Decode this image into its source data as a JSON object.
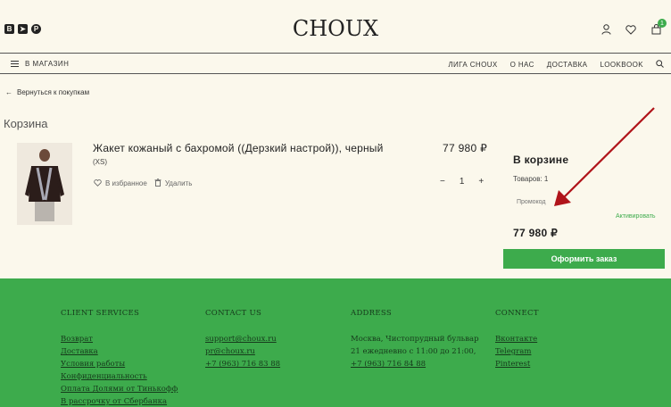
{
  "header": {
    "logo": "CHOUX",
    "social": [
      "В",
      "➤",
      "P"
    ],
    "cart_count": "1",
    "icons": [
      "user-icon",
      "heart-icon",
      "cart-icon"
    ]
  },
  "nav": {
    "shop": "В МАГАЗИН",
    "links": [
      "ЛИГА CHOUX",
      "О НАС",
      "ДОСТАВКА",
      "LOOKBOOK"
    ]
  },
  "back_link": "Вернуться к покупкам",
  "page_title": "Корзина",
  "product": {
    "name": "Жакет кожаный с бахромой ((Дерзкий настрой)), черный",
    "size": "(XS)",
    "to_favorites": "В избранное",
    "delete": "Удалить",
    "price": "77 980 ₽",
    "qty_minus": "−",
    "qty": "1",
    "qty_plus": "+"
  },
  "summary": {
    "title": "В корзине",
    "count": "Товаров: 1",
    "promo_placeholder": "Промокод",
    "activate": "Активировать",
    "total": "77 980 ₽",
    "order_button": "Оформить заказ"
  },
  "footer": {
    "client_services": {
      "heading": "CLIENT SERVICES",
      "items": [
        "Возврат",
        "Доставка",
        "Условия работы",
        "Конфиденциальность",
        "Оплата Долями от Тинькофф",
        "В рассрочку от Сбербанка"
      ]
    },
    "contact": {
      "heading": "CONTACT US",
      "items": [
        "support@choux.ru",
        "pr@choux.ru",
        "+7 (963) 716 83 88"
      ]
    },
    "address": {
      "heading": "ADDRESS",
      "lines": [
        "Москва, Чистопрудный бульвар",
        "21 ежедневно с 11:00 до 21:00,"
      ],
      "phone": "+7 (963) 716 84 88"
    },
    "connect": {
      "heading": "CONNECT",
      "items": [
        "Вконтакте",
        "Telegram",
        "Pinterest"
      ]
    }
  },
  "colors": {
    "accent": "#3dab4c",
    "background": "#fbf8ec",
    "annotation_arrow": "#b0141a"
  }
}
